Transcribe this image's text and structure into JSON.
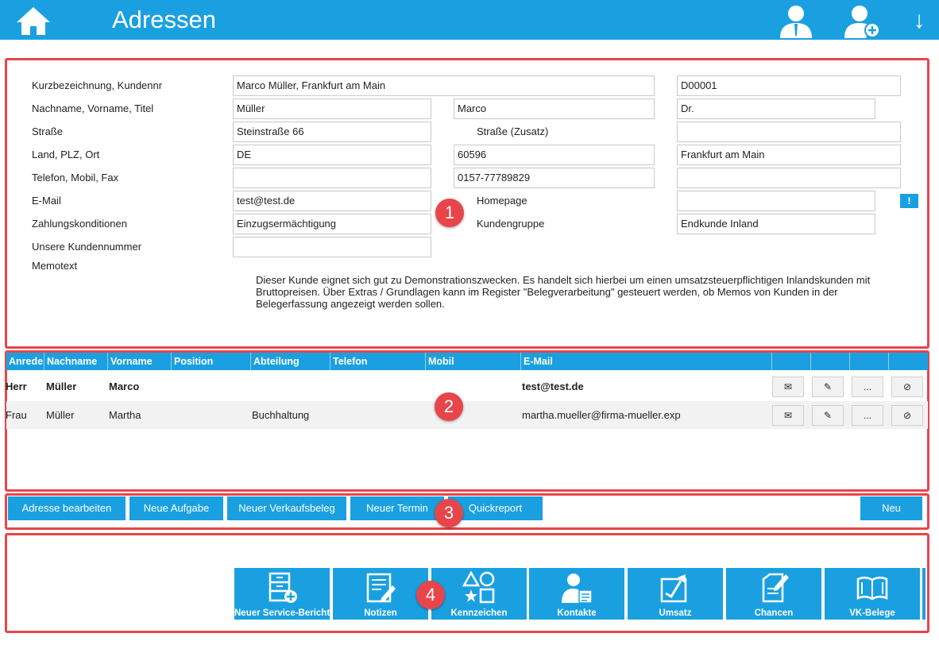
{
  "header": {
    "title": "Adressen",
    "arrow_glyph": "↓",
    "icons": [
      "home-icon",
      "user-icon",
      "user-add-icon",
      "download-arrow-icon"
    ]
  },
  "form": {
    "labels": {
      "kurzbezeichnung": "Kurzbezeichnung, Kundennr",
      "name": "Nachname, Vorname, Titel",
      "strasse": "Straße",
      "strasse_zusatz": "Straße (Zusatz)",
      "land": "Land, PLZ, Ort",
      "telefon": "Telefon, Mobil, Fax",
      "email": "E-Mail",
      "homepage": "Homepage",
      "zahlung": "Zahlungskonditionen",
      "kundengruppe": "Kundengruppe",
      "unsere_kundennummer": "Unsere Kundennummer",
      "memotext": "Memotext"
    },
    "values": {
      "kurzbezeichnung": "Marco Müller, Frankfurt am Main",
      "kundennr": "D00001",
      "nachname": "Müller",
      "vorname": "Marco",
      "titel": "Dr.",
      "strasse": "Steinstraße 66",
      "strasse_zusatz": "",
      "land": "DE",
      "plz": "60596",
      "ort": "Frankfurt am Main",
      "telefon": "",
      "mobil": "0157-77789829",
      "fax": "",
      "email": "test@test.de",
      "homepage": "",
      "zahlung": "Einzugsermächtigung",
      "kundengruppe": "Endkunde Inland",
      "unsere_kundennummer": ""
    },
    "homepage_button": "!",
    "memo": "Dieser Kunde eignet sich gut zu Demonstrationszwecken. Es handelt sich hierbei um einen umsatzsteuerpflichtigen Inlandskunden mit Bruttopreisen. Über Extras / Grundlagen kann im Register \"Belegverarbeitung\" gesteuert werden, ob Memos von Kunden in der Belegerfassung angezeigt werden sollen."
  },
  "contacts": {
    "columns": [
      "Anrede",
      "Nachname",
      "Vorname",
      "Position",
      "Abteilung",
      "Telefon",
      "Mobil",
      "E-Mail"
    ],
    "rows": [
      {
        "anrede": "Herr",
        "nachname": "Müller",
        "vorname": "Marco",
        "position": "",
        "abteilung": "",
        "telefon": "",
        "mobil": "",
        "email": "test@test.de"
      },
      {
        "anrede": "Frau",
        "nachname": "Müller",
        "vorname": "Martha",
        "position": "",
        "abteilung": "Buchhaltung",
        "telefon": "",
        "mobil": "",
        "email": "martha.mueller@firma-mueller.exp"
      }
    ],
    "row_buttons": {
      "mail": "✉",
      "edit": "✎",
      "more": "...",
      "delete": "⊘"
    }
  },
  "actions": {
    "adresse_bearbeiten": "Adresse bearbeiten",
    "neue_aufgabe": "Neue Aufgabe",
    "neuer_verkaufsbeleg": "Neuer Verkaufsbeleg",
    "neuer_termin": "Neuer Termin",
    "quickreport": "Quickreport",
    "neu": "Neu"
  },
  "tiles": {
    "service": "Neuer Service-Bericht",
    "notizen": "Notizen",
    "kennzeichen": "Kennzeichen",
    "kontakte": "Kontakte",
    "umsatz": "Umsatz",
    "chancen": "Chancen",
    "vk_belege": "VK-Belege"
  },
  "markers": [
    "1",
    "2",
    "3",
    "4"
  ],
  "colors": {
    "accent": "#1aa0e0",
    "highlight": "#e8454a"
  }
}
